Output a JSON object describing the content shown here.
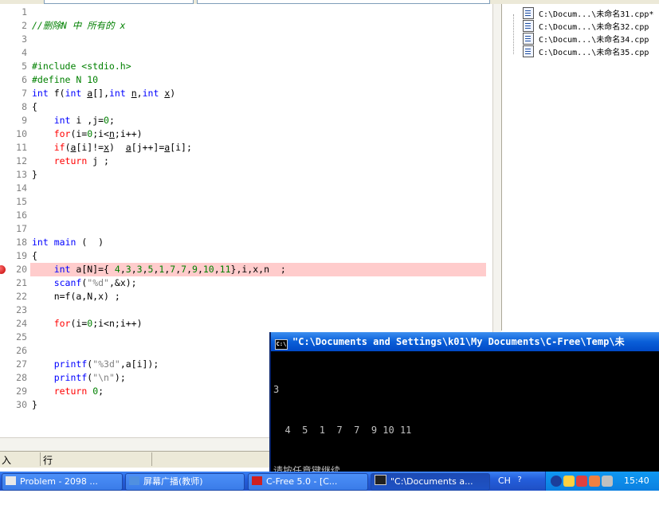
{
  "editor": {
    "lines": [
      {
        "n": "1",
        "tokens": []
      },
      {
        "n": "2",
        "tokens": [
          [
            "cm",
            "//删除N 中 所有的 x"
          ]
        ]
      },
      {
        "n": "3",
        "tokens": []
      },
      {
        "n": "4",
        "tokens": []
      },
      {
        "n": "5",
        "tokens": [
          [
            "pp",
            "#include <stdio.h>"
          ]
        ]
      },
      {
        "n": "6",
        "tokens": [
          [
            "pp",
            "#define N 10"
          ]
        ]
      },
      {
        "n": "7",
        "tokens": [
          [
            "kw",
            "int"
          ],
          [
            "tx",
            " f("
          ],
          [
            "kw",
            "int"
          ],
          [
            "tx",
            " "
          ],
          [
            "ul",
            "a"
          ],
          [
            "tx",
            "[],"
          ],
          [
            "kw",
            "int"
          ],
          [
            "tx",
            " "
          ],
          [
            "ul",
            "n"
          ],
          [
            "tx",
            ","
          ],
          [
            "kw",
            "int"
          ],
          [
            "tx",
            " "
          ],
          [
            "ul",
            "x"
          ],
          [
            "tx",
            ")"
          ]
        ]
      },
      {
        "n": "8",
        "tokens": [
          [
            "tx",
            "{"
          ]
        ]
      },
      {
        "n": "9",
        "tokens": [
          [
            "tx",
            "    "
          ],
          [
            "kw",
            "int"
          ],
          [
            "tx",
            " i ,j="
          ],
          [
            "nm",
            "0"
          ],
          [
            "tx",
            ";"
          ]
        ]
      },
      {
        "n": "10",
        "tokens": [
          [
            "tx",
            "    "
          ],
          [
            "rd",
            "for"
          ],
          [
            "tx",
            "(i="
          ],
          [
            "nm",
            "0"
          ],
          [
            "tx",
            ";i<"
          ],
          [
            "ul",
            "n"
          ],
          [
            "tx",
            ";i++)"
          ]
        ]
      },
      {
        "n": "11",
        "tokens": [
          [
            "tx",
            "    "
          ],
          [
            "rd",
            "if"
          ],
          [
            "tx",
            "("
          ],
          [
            "ul",
            "a"
          ],
          [
            "tx",
            "[i]!="
          ],
          [
            "ul",
            "x"
          ],
          [
            "tx",
            ")  "
          ],
          [
            "ul",
            "a"
          ],
          [
            "tx",
            "[j++]="
          ],
          [
            "ul",
            "a"
          ],
          [
            "tx",
            "[i];"
          ]
        ]
      },
      {
        "n": "12",
        "tokens": [
          [
            "tx",
            "    "
          ],
          [
            "rd",
            "return"
          ],
          [
            "tx",
            " j ;"
          ]
        ]
      },
      {
        "n": "13",
        "tokens": [
          [
            "tx",
            "}"
          ]
        ]
      },
      {
        "n": "14",
        "tokens": []
      },
      {
        "n": "15",
        "tokens": []
      },
      {
        "n": "16",
        "tokens": []
      },
      {
        "n": "17",
        "tokens": []
      },
      {
        "n": "18",
        "tokens": [
          [
            "kw",
            "int"
          ],
          [
            "tx",
            " "
          ],
          [
            "kw",
            "main"
          ],
          [
            "tx",
            " (  )"
          ]
        ]
      },
      {
        "n": "19",
        "tokens": [
          [
            "tx",
            "{"
          ]
        ]
      },
      {
        "n": "20",
        "hl": true,
        "bp": true,
        "tokens": [
          [
            "tx",
            "    "
          ],
          [
            "kw",
            "int"
          ],
          [
            "tx",
            " a[N]={ "
          ],
          [
            "nm",
            "4"
          ],
          [
            "tx",
            ","
          ],
          [
            "nm",
            "3"
          ],
          [
            "tx",
            ","
          ],
          [
            "nm",
            "3"
          ],
          [
            "tx",
            ","
          ],
          [
            "nm",
            "5"
          ],
          [
            "tx",
            ","
          ],
          [
            "nm",
            "1"
          ],
          [
            "tx",
            ","
          ],
          [
            "nm",
            "7"
          ],
          [
            "tx",
            ","
          ],
          [
            "nm",
            "7"
          ],
          [
            "tx",
            ","
          ],
          [
            "nm",
            "9"
          ],
          [
            "tx",
            ","
          ],
          [
            "nm",
            "10"
          ],
          [
            "tx",
            ","
          ],
          [
            "nm",
            "11"
          ],
          [
            "tx",
            "},i,x,n  ;"
          ]
        ]
      },
      {
        "n": "21",
        "tokens": [
          [
            "tx",
            "    "
          ],
          [
            "kw",
            "scanf"
          ],
          [
            "tx",
            "("
          ],
          [
            "st",
            "\"%d\""
          ],
          [
            "tx",
            ",&x);"
          ]
        ]
      },
      {
        "n": "22",
        "tokens": [
          [
            "tx",
            "    n=f(a,N,x) ;"
          ]
        ]
      },
      {
        "n": "23",
        "tokens": []
      },
      {
        "n": "24",
        "tokens": [
          [
            "tx",
            "    "
          ],
          [
            "rd",
            "for"
          ],
          [
            "tx",
            "(i="
          ],
          [
            "nm",
            "0"
          ],
          [
            "tx",
            ";i<n;i++)"
          ]
        ]
      },
      {
        "n": "25",
        "tokens": []
      },
      {
        "n": "26",
        "tokens": []
      },
      {
        "n": "27",
        "tokens": [
          [
            "tx",
            "    "
          ],
          [
            "kw",
            "printf"
          ],
          [
            "tx",
            "("
          ],
          [
            "st",
            "\"%3d\""
          ],
          [
            "tx",
            ",a[i]);"
          ]
        ]
      },
      {
        "n": "28",
        "tokens": [
          [
            "tx",
            "    "
          ],
          [
            "kw",
            "printf"
          ],
          [
            "tx",
            "("
          ],
          [
            "st",
            "\"\\n\""
          ],
          [
            "tx",
            ");"
          ]
        ]
      },
      {
        "n": "29",
        "tokens": [
          [
            "tx",
            "    "
          ],
          [
            "rd",
            "return"
          ],
          [
            "tx",
            " "
          ],
          [
            "nm",
            "0"
          ],
          [
            "tx",
            ";"
          ]
        ]
      },
      {
        "n": "30",
        "tokens": [
          [
            "tx",
            "}"
          ]
        ]
      }
    ]
  },
  "file_tree": {
    "items": [
      {
        "label": "C:\\Docum...\\未命名31.cpp*"
      },
      {
        "label": "C:\\Docum...\\未命名32.cpp"
      },
      {
        "label": "C:\\Docum...\\未命名34.cpp"
      },
      {
        "label": "C:\\Docum...\\未命名35.cpp"
      }
    ]
  },
  "status_bar": {
    "left": "入",
    "right": "行"
  },
  "console": {
    "icon_text": "C:\\",
    "title": "\"C:\\Documents and Settings\\k01\\My Documents\\C-Free\\Temp\\未",
    "lines": [
      "3",
      "  4  5  1  7  7  9 10 11",
      "请按任意键继续. . ."
    ]
  },
  "taskbar": {
    "tasks": [
      {
        "label": "Problem - 2098 ...",
        "color": "#e8e8e8"
      },
      {
        "label": "屏幕广播(教师)",
        "color": "#5090e0"
      },
      {
        "label": "C-Free 5.0 - [C...",
        "color": "#d02020"
      },
      {
        "label": "\"C:\\Documents a...",
        "color": "#202020"
      }
    ],
    "language": "CH",
    "clock": "15:40"
  }
}
